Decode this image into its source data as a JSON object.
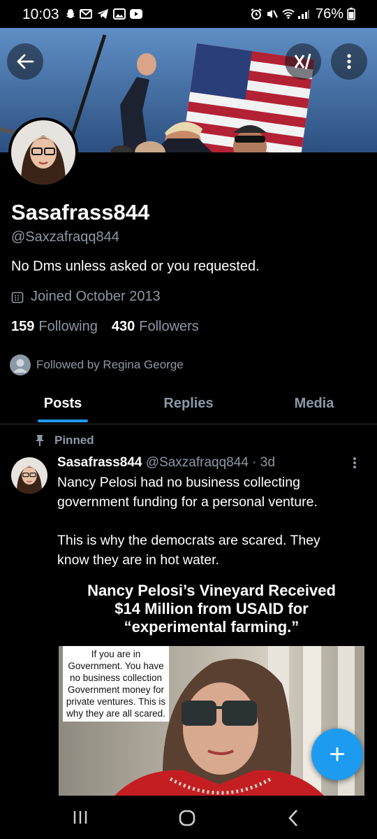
{
  "status_bar": {
    "time": "10:03",
    "battery": "76%"
  },
  "profile": {
    "display_name": "Sasafrass844",
    "handle": "@Saxzafraqq844",
    "bio": "No Dms unless asked or you requested.",
    "joined": "Joined October 2013",
    "following_count": "159",
    "following_label": "Following",
    "followers_count": "430",
    "followers_label": "Followers",
    "followed_by": "Followed by Regina George"
  },
  "tabs": [
    {
      "label": "Posts",
      "active": true
    },
    {
      "label": "Replies",
      "active": false
    },
    {
      "label": "Media",
      "active": false
    }
  ],
  "post": {
    "pinned_label": "Pinned",
    "author": "Sasafrass844",
    "handle": "@Saxzafraqq844",
    "separator": "·",
    "time": "3d",
    "text_line1": "Nancy Pelosi had no business collecting",
    "text_line2": "government funding for a personal venture.",
    "text_line3": "This is why the democrats are scared. They",
    "text_line4": "know they are in hot water.",
    "media": {
      "headline_line1": "Nancy Pelosi’s Vineyard Received",
      "headline_line2": "$14 Million from USAID for",
      "headline_line3": "“experimental farming.”",
      "caption_lines": [
        "If you are in",
        "Government. You have",
        "no business collection",
        "Government money for",
        "private ventures. This is",
        "why they are all scared."
      ]
    }
  },
  "fab": {
    "label": "+"
  },
  "colors": {
    "accent": "#1d9bf0",
    "background": "#000000",
    "muted": "#8b98a5"
  },
  "icons": [
    "back-arrow-icon",
    "grok-icon",
    "more-vertical-icon",
    "calendar-icon",
    "pin-icon",
    "compose-plus-icon"
  ]
}
